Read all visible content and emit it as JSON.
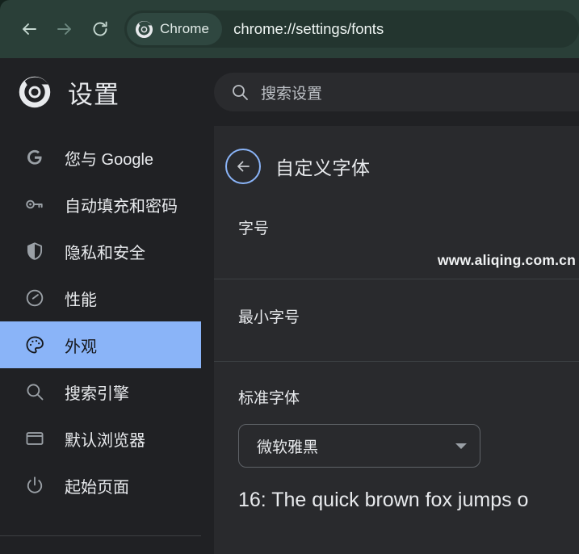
{
  "browser": {
    "back_icon": "back-arrow-icon",
    "forward_icon": "forward-arrow-icon",
    "reload_icon": "reload-icon",
    "chrome_pill_label": "Chrome",
    "chrome_logo_icon": "chrome-logo-icon",
    "url": "chrome://settings/fonts",
    "toolbar_color": "#2a3f38"
  },
  "settings": {
    "brand_title": "设置",
    "brand_logo_icon": "chrome-logo-icon",
    "search": {
      "icon": "search-icon",
      "placeholder": "搜索设置",
      "value": ""
    }
  },
  "sidebar": {
    "items": [
      {
        "label": "您与 Google",
        "icon": "google-g-icon",
        "selected": false
      },
      {
        "label": "自动填充和密码",
        "icon": "key-icon",
        "selected": false
      },
      {
        "label": "隐私和安全",
        "icon": "shield-icon",
        "selected": false
      },
      {
        "label": "性能",
        "icon": "speedometer-icon",
        "selected": false
      },
      {
        "label": "外观",
        "icon": "palette-icon",
        "selected": true
      },
      {
        "label": "搜索引擎",
        "icon": "search-icon",
        "selected": false
      },
      {
        "label": "默认浏览器",
        "icon": "window-icon",
        "selected": false
      },
      {
        "label": "起始页面",
        "icon": "power-icon",
        "selected": false
      }
    ],
    "selected_color": "#8ab4f8"
  },
  "main": {
    "back_icon": "back-arrow-icon",
    "page_title": "自定义字体",
    "sections": [
      {
        "label": "字号"
      },
      {
        "label": "最小字号"
      },
      {
        "label": "标准字体"
      }
    ],
    "font_select": {
      "value": "微软雅黑",
      "chevron_icon": "chevron-down-icon"
    },
    "preview_text": "16: The quick brown fox jumps o",
    "watermark": "www.aliqing.com.cn"
  }
}
